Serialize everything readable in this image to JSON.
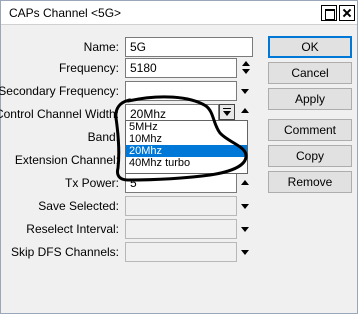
{
  "window": {
    "title": "CAPs Channel <5G>"
  },
  "form": {
    "name": {
      "label": "Name:",
      "value": "5G"
    },
    "frequency": {
      "label": "Frequency:",
      "value": "5180"
    },
    "secondary_frequency": {
      "label": "Secondary Frequency:",
      "value": ""
    },
    "control_channel_width": {
      "label": "Control Channel Width:",
      "value": "20Mhz"
    },
    "band": {
      "label": "Band:"
    },
    "extension_channel": {
      "label": "Extension Channel:"
    },
    "tx_power": {
      "label": "Tx Power:",
      "value": "5"
    },
    "save_selected": {
      "label": "Save Selected:",
      "value": ""
    },
    "reselect_interval": {
      "label": "Reselect Interval:",
      "value": ""
    },
    "skip_dfs_channels": {
      "label": "Skip DFS Channels:",
      "value": ""
    }
  },
  "dropdown": {
    "options": [
      "5MHz",
      "10Mhz",
      "20Mhz",
      "40Mhz turbo"
    ],
    "selected": "20Mhz"
  },
  "buttons": {
    "ok": "OK",
    "cancel": "Cancel",
    "apply": "Apply",
    "comment": "Comment",
    "copy": "Copy",
    "remove": "Remove"
  },
  "colors": {
    "selection": "#0078d7",
    "annotation_ink": "#000000"
  }
}
